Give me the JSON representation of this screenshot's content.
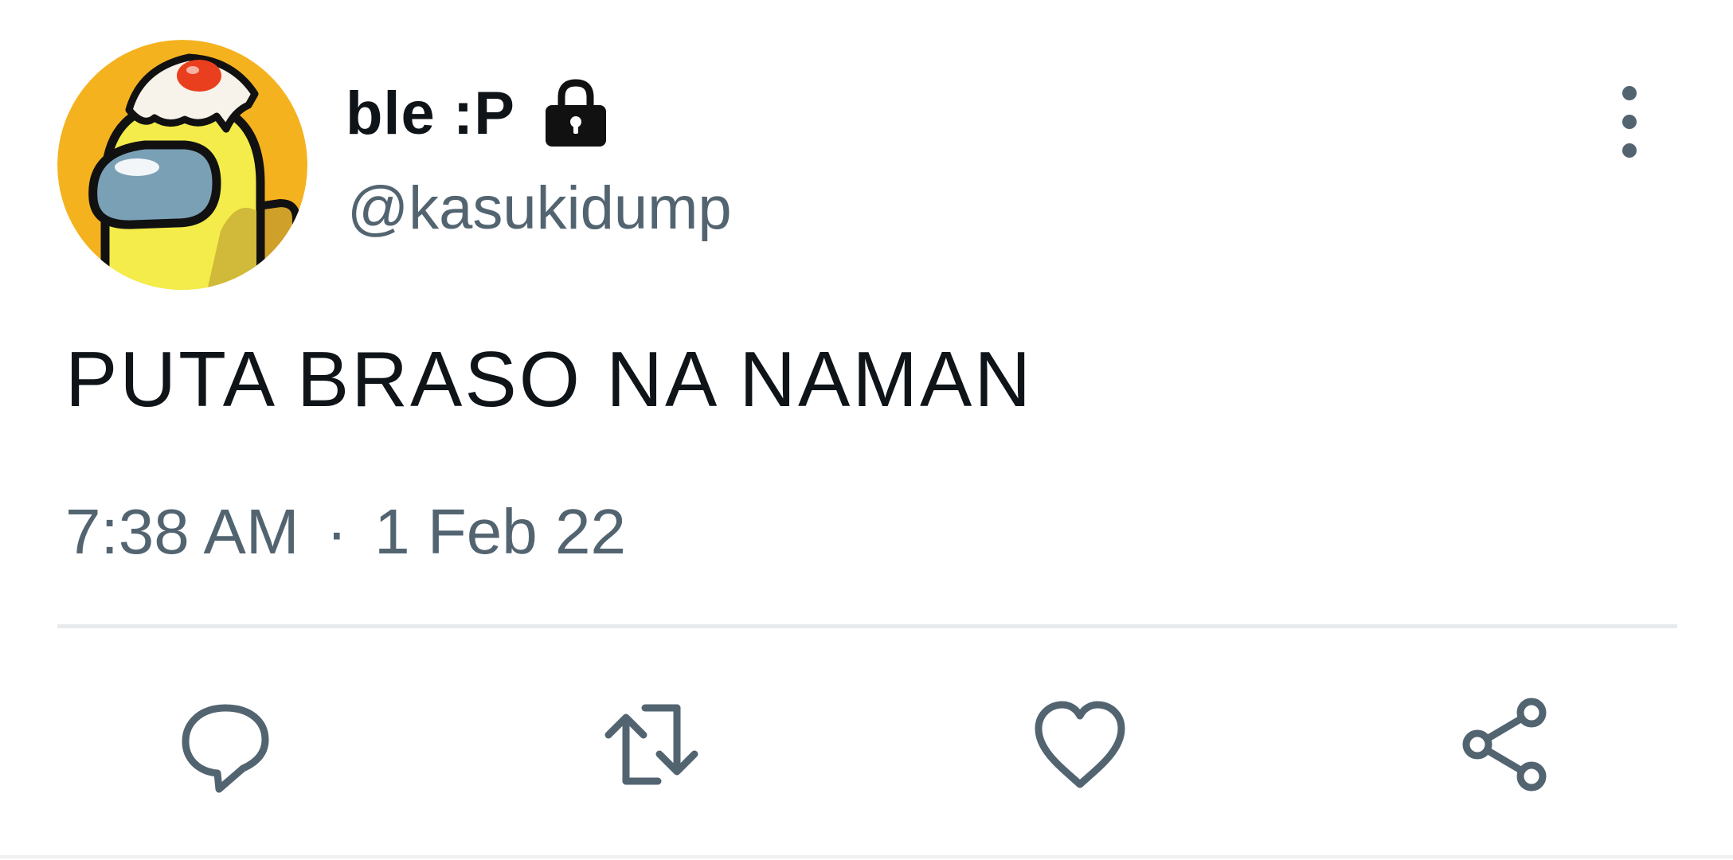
{
  "user": {
    "display_name": "ble :P",
    "handle": "@kasukidump",
    "protected": true,
    "avatar_icon": "yellow-crewmate-egg-hat-avatar"
  },
  "tweet": {
    "text": "PUTA BRASO NA NAMAN",
    "time": "7:38 AM",
    "separator": "·",
    "date": "1 Feb 22"
  },
  "actions": [
    {
      "name": "reply",
      "icon": "speech-bubble-icon"
    },
    {
      "name": "retweet",
      "icon": "retweet-arrows-icon"
    },
    {
      "name": "like",
      "icon": "heart-icon"
    },
    {
      "name": "share",
      "icon": "share-nodes-icon"
    }
  ],
  "colors": {
    "text_primary": "#0f1419",
    "text_secondary": "#536471",
    "divider": "#e7eaec",
    "avatar_bg": "#f5b21f"
  }
}
